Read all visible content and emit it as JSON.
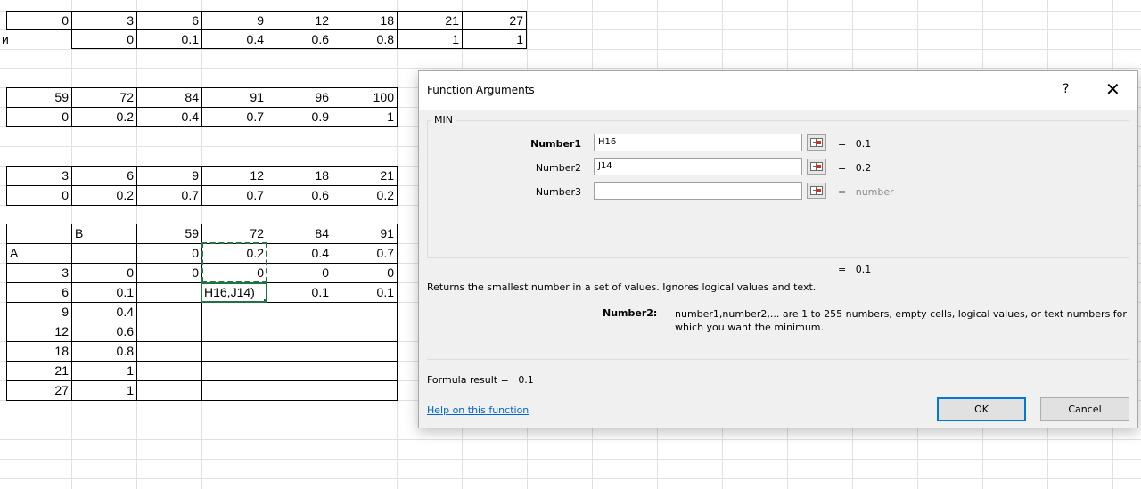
{
  "sheet": {
    "fragment": "и",
    "table1": {
      "row1": [
        "0",
        "3",
        "6",
        "9",
        "12",
        "18",
        "21",
        "27"
      ],
      "row2": [
        "0",
        "0.1",
        "0.4",
        "0.6",
        "0.8",
        "1",
        "1"
      ]
    },
    "table2": {
      "row1": [
        "59",
        "72",
        "84",
        "91",
        "96",
        "100"
      ],
      "row2": [
        "0",
        "0.2",
        "0.4",
        "0.7",
        "0.9",
        "1"
      ]
    },
    "table3": {
      "row1": [
        "3",
        "6",
        "9",
        "12",
        "18",
        "21"
      ],
      "row2": [
        "0",
        "0.2",
        "0.7",
        "0.7",
        "0.6",
        "0.2"
      ]
    },
    "table4": {
      "header_b": "B",
      "header_vals": [
        "59",
        "72",
        "84",
        "91"
      ],
      "row_a_label": "A",
      "row_a_vals": [
        "0",
        "0.2",
        "0.4",
        "0.7"
      ],
      "row3_vals": [
        "0",
        "0",
        "0",
        "0"
      ],
      "row6_vals": [
        "0.1",
        "0.1"
      ],
      "active_cell_text": "H16,J14)",
      "left_labels": [
        "3",
        "6",
        "9",
        "12",
        "18",
        "21",
        "27"
      ],
      "second_col": [
        "0",
        "0.1",
        "0.4",
        "0.6",
        "0.8",
        "1",
        "1"
      ]
    }
  },
  "dialog": {
    "title": "Function Arguments",
    "help_glyph": "?",
    "close_glyph": "✕",
    "function_name": "MIN",
    "args": [
      {
        "label": "Number1",
        "value": "H16",
        "result": "0.1"
      },
      {
        "label": "Number2",
        "value": "J14",
        "result": "0.2"
      },
      {
        "label": "Number3",
        "value": "",
        "result": "number"
      }
    ],
    "eq": "=",
    "overall_result": "0.1",
    "description": "Returns the smallest number in a set of values. Ignores logical values and text.",
    "arg_help_name": "Number2:",
    "arg_help_text": "number1,number2,... are 1 to 255 numbers, empty cells, logical values, or text numbers for which you want the minimum.",
    "formula_result_label": "Formula result =",
    "formula_result_value": "0.1",
    "help_link": "Help on this function",
    "ok_label": "OK",
    "cancel_label": "Cancel"
  }
}
